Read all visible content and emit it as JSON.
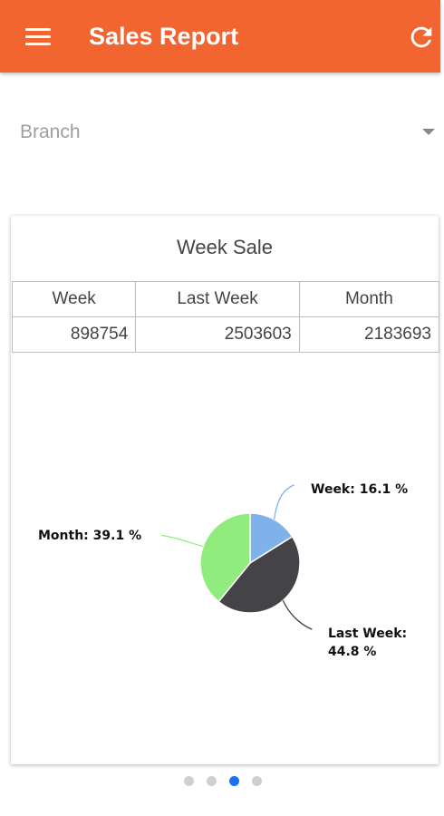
{
  "header": {
    "title": "Sales Report",
    "menu_icon": "menu-icon",
    "refresh_icon": "refresh-icon"
  },
  "branch": {
    "label": "Branch"
  },
  "card": {
    "title": "Week Sale",
    "table": {
      "headers": [
        "Week",
        "Last Week",
        "Month"
      ],
      "values": [
        "898754",
        "2503603",
        "2183693"
      ]
    }
  },
  "chart_data": {
    "type": "pie",
    "slices": [
      {
        "label": "Week",
        "value": 16.1,
        "color": "#7fb2ea"
      },
      {
        "label": "Last Week",
        "value": 44.8,
        "color": "#434348"
      },
      {
        "label": "Month",
        "value": 39.1,
        "color": "#90ed7d"
      }
    ],
    "data_labels": [
      "Week: 16.1 %",
      "Last Week:",
      "44.8 %",
      "Month: 39.1 %"
    ]
  },
  "pager": {
    "count": 4,
    "active_index": 2,
    "active_color": "#1a73e8",
    "inactive_color": "#cfcfcf"
  },
  "colors": {
    "appbar": "#f26430"
  }
}
